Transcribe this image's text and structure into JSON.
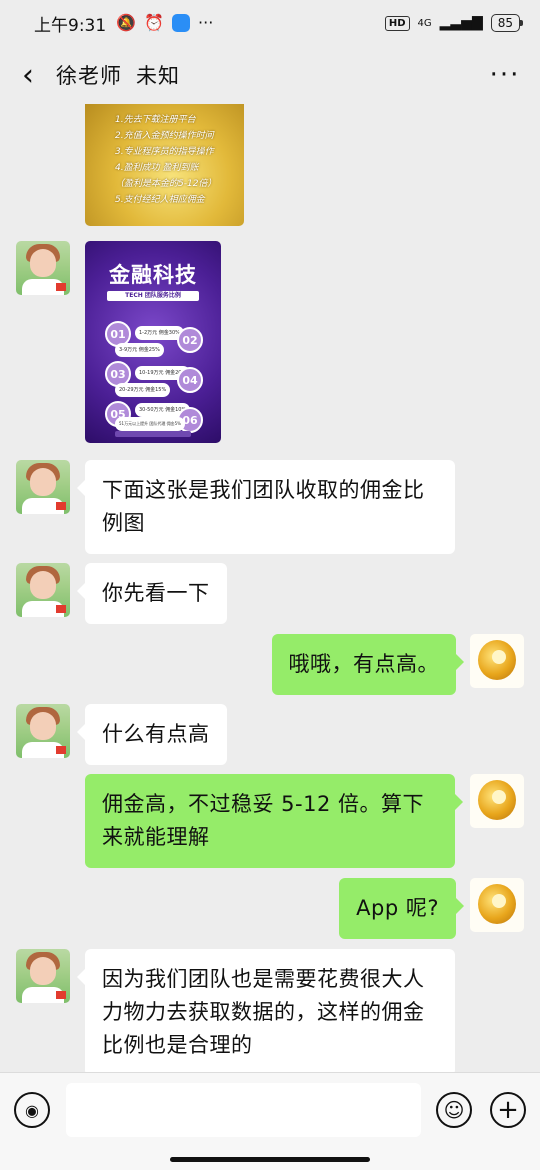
{
  "statusbar": {
    "time": "上午9:31",
    "icons": [
      "mute-bell-icon",
      "alarm-icon",
      "app-notification-icon",
      "more-dots-icon"
    ],
    "more_dots": "···",
    "hd": "HD",
    "network": "4G",
    "signal_icon": "signal-bars-icon",
    "battery": "85"
  },
  "header": {
    "back_icon": "‹",
    "name": "徐老师",
    "status": "未知",
    "more": "···"
  },
  "image1": {
    "lines": [
      "1.先去下载注册平台",
      "2.充值入金预约操作时间",
      "3.专业程序员的指导操作",
      "4.盈利成功 盈利到账",
      "（盈利是本金的5-12倍）",
      "5.支付经纪人相应佣金"
    ]
  },
  "image2": {
    "title": "金融科技",
    "subtitle": "TECH 团队服务比例",
    "steps": [
      "01",
      "02",
      "03",
      "04",
      "05",
      "06"
    ],
    "rates": [
      "1-2万元 佣金30%",
      "3-9万元 佣金25%",
      "10-19万元 佣金20%",
      "20-29万元 佣金15%",
      "30-50万元 佣金10%",
      "51万元以上提升 团队代理 佣金5%"
    ]
  },
  "messages": [
    {
      "side": "left",
      "text": "下面这张是我们团队收取的佣金比例图"
    },
    {
      "side": "left",
      "text": "你先看一下"
    },
    {
      "side": "right",
      "text": "哦哦，有点高。"
    },
    {
      "side": "left",
      "text": "什么有点高"
    },
    {
      "side": "right",
      "text": "佣金高，不过稳妥 5-12 倍。算下来就能理解"
    },
    {
      "side": "right",
      "text": "App 呢?"
    },
    {
      "side": "left",
      "text": "因为我们团队也是需要花费很大人力物力去获取数据的，这样的佣金比例也是合理的"
    }
  ],
  "inputbar": {
    "voice_icon": "voice-icon",
    "emoji_icon": "emoji-icon",
    "plus_icon": "plus-icon",
    "voice_glyph": "◉",
    "emoji_glyph": "☺",
    "plus_glyph": "+"
  }
}
